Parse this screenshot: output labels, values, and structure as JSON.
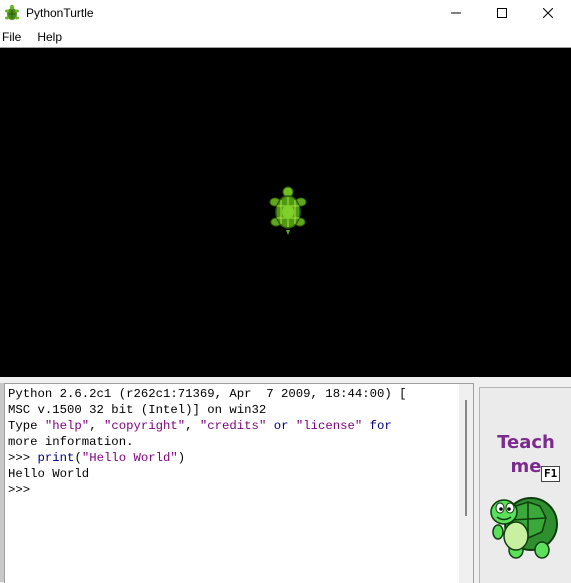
{
  "window": {
    "title": "PythonTurtle",
    "icon": "turtle-app-icon",
    "controls": [
      "minimize-icon",
      "maximize-icon",
      "close-icon"
    ]
  },
  "menu": {
    "items": [
      {
        "label": "File"
      },
      {
        "label": "Help"
      }
    ]
  },
  "canvas": {
    "background": "#000000",
    "turtle_icon": "turtle-icon"
  },
  "console": {
    "lines": [
      "Python 2.6.2c1 (r262c1:71369, Apr  7 2009, 18:44:00) [",
      "MSC v.1500 32 bit (Intel)] on win32"
    ],
    "info_line": {
      "prefix": "Type ",
      "help": "\"help\"",
      "sep1": ", ",
      "copyright": "\"copyright\"",
      "sep2": ", ",
      "credits": "\"credits\"",
      "or": " or ",
      "license": "\"license\"",
      "for": " for"
    },
    "info_line2": "more information.",
    "command": {
      "prompt": ">>> ",
      "keyword": "print",
      "args_open": "(",
      "arg": "\"Hello World\"",
      "args_close": ")"
    },
    "output": "Hello World",
    "prompt": ">>>"
  },
  "teach_panel": {
    "label_line1": "Teach",
    "label_line2": "me",
    "shortcut": "F1",
    "label_color": "#7b2b8f"
  }
}
